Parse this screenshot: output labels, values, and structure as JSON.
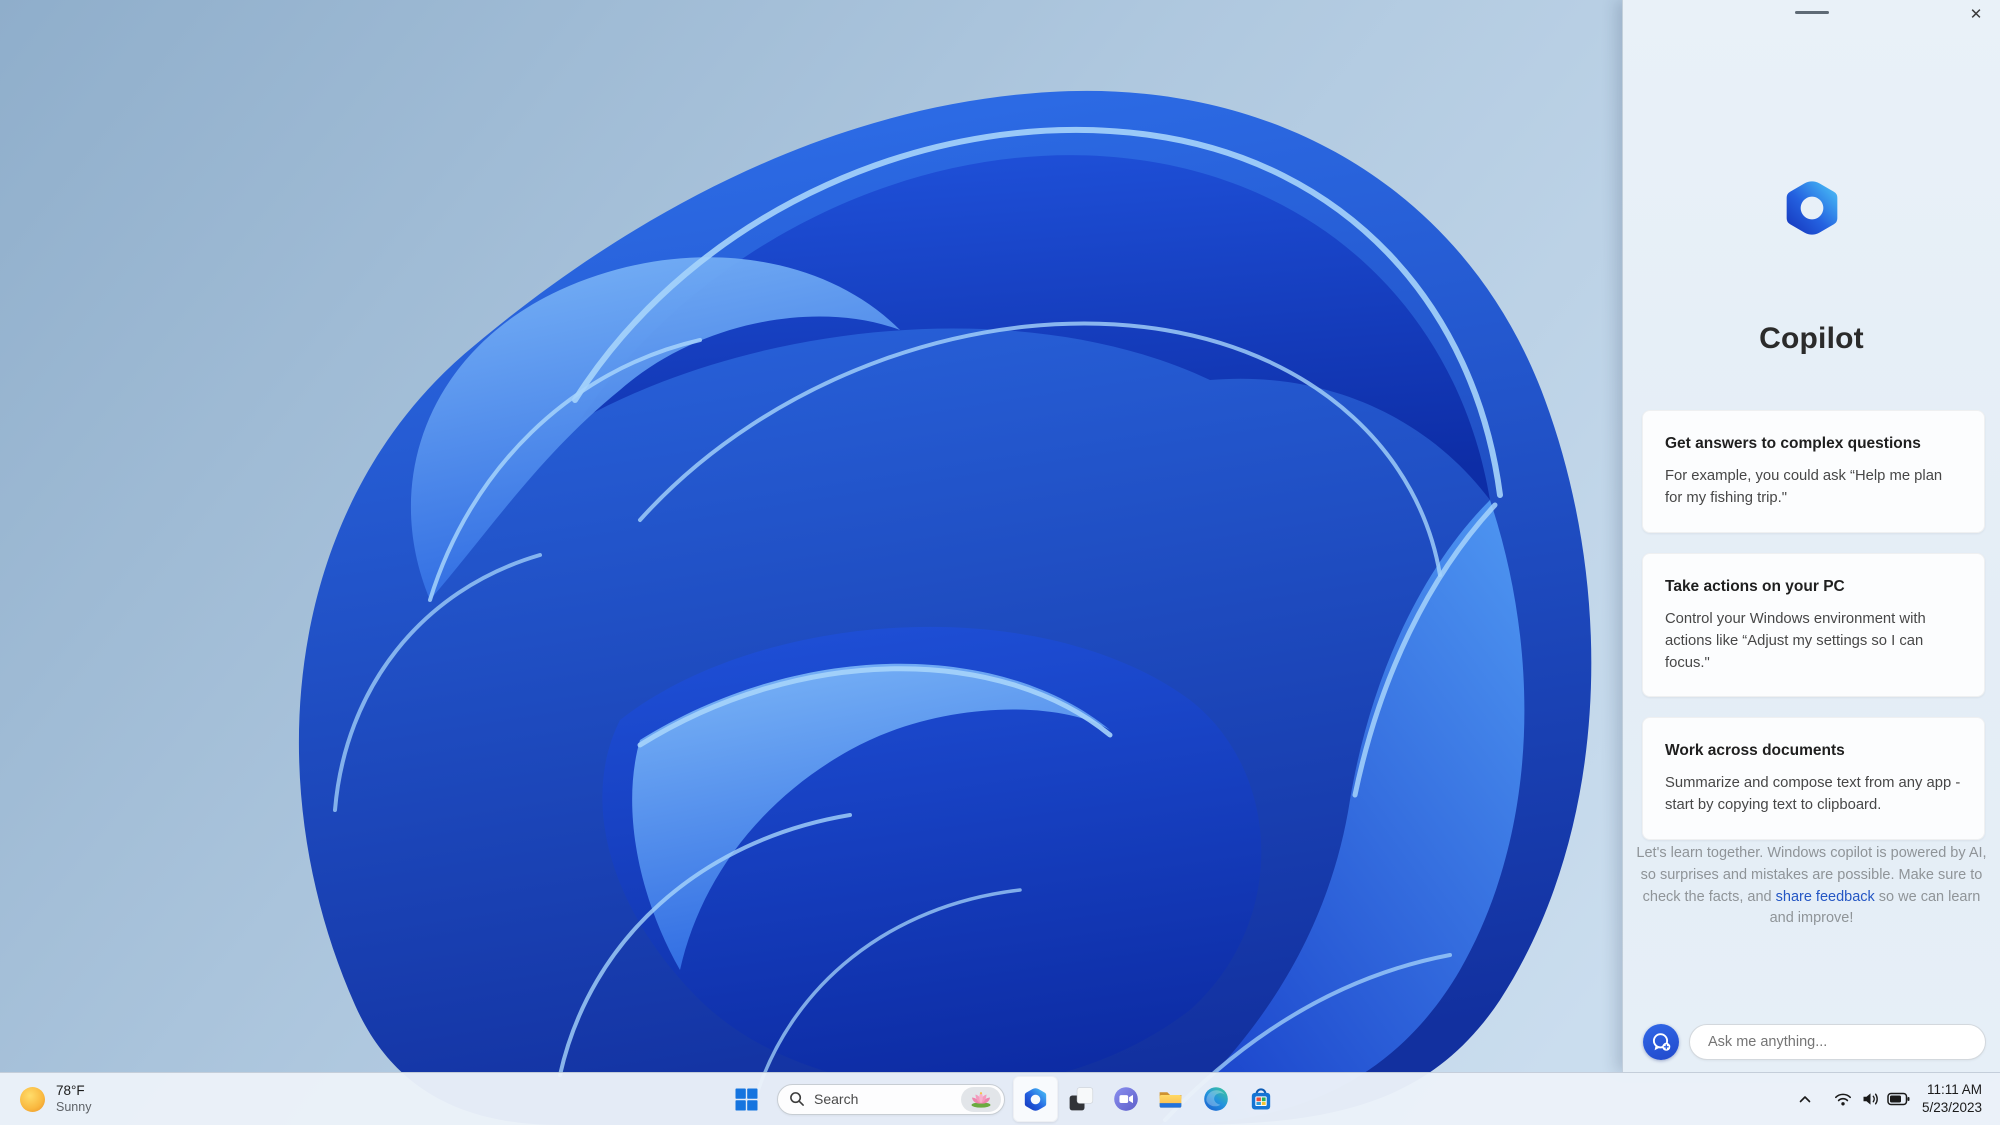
{
  "copilot_panel": {
    "title": "Copilot",
    "cards": [
      {
        "title": "Get answers to complex questions",
        "body": "For example, you could ask “Help me plan for my fishing trip.\""
      },
      {
        "title": "Take actions on your PC",
        "body": "Control your Windows environment with actions like “Adjust my settings so I can focus.\""
      },
      {
        "title": "Work across documents",
        "body": "Summarize and compose text from any app - start by copying text to clipboard."
      }
    ],
    "disclaimer_part1": "Let's learn together. Windows copilot is powered by AI, so surprises and mistakes are possible. Make sure to check the facts, and ",
    "disclaimer_link": "share feedback",
    "disclaimer_part2": " so we can learn and improve!",
    "input_placeholder": "Ask me anything...",
    "close_glyph": "✕"
  },
  "taskbar": {
    "weather_temp": "78°F",
    "weather_condition": "Sunny",
    "search_placeholder": "Search",
    "time": "11:11 AM",
    "date": "5/23/2023"
  },
  "icons": {
    "panel_logo": "copilot-logo",
    "taskbar_apps": [
      "copilot",
      "task-view",
      "chat",
      "file-explorer",
      "edge",
      "store"
    ],
    "tray": [
      "hidden-icons-chevron",
      "wifi",
      "volume",
      "battery"
    ]
  },
  "colors": {
    "accent_blue": "#2563E3",
    "link_blue": "#2456C4",
    "panel_bg": "#E7F0F8",
    "taskbar_bg": "#EBF2F9",
    "bloom_deep": "#0C2BA4",
    "bloom_mid": "#2E6FEA",
    "bloom_edge": "#A6D4FB"
  }
}
